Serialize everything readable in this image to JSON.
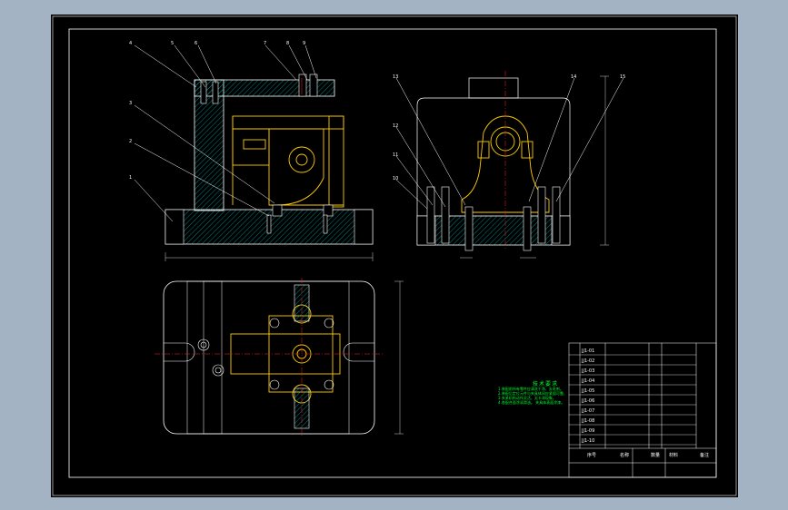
{
  "colors": {
    "background": "#a3b3c4",
    "paper": "#000000",
    "frame": "#ffffff",
    "hatch": "#00a0a0",
    "fixture_part": "#ffcc00",
    "center_line": "#ff2020",
    "leader": "#ffffff",
    "note_text": "#00ff33"
  },
  "front_view_labels": [
    "4",
    "5",
    "6",
    "7",
    "8",
    "9",
    "3",
    "2",
    "1"
  ],
  "side_view_labels": [
    "13",
    "12",
    "11",
    "10",
    "14",
    "15"
  ],
  "tech_requirements": {
    "title": "技术要求",
    "lines": [
      "1.装配前所有零件应清洗干净，去毛刺。",
      "2.装配后定位元件与夹具体间应紧固可靠，",
      "3.夹紧机构动作灵活，无卡滞现象。",
      "4.各配合面涂润滑油。   夹具体表面涂漆。"
    ]
  },
  "title_block": {
    "cells": [
      "JJ1-01",
      "JJ1-02",
      "JJ1-03",
      "JJ1-04",
      "JJ1-05",
      "JJ1-06",
      "JJ1-07",
      "JJ1-08",
      "JJ1-09",
      "JJ1-10"
    ],
    "footer": [
      "序号",
      "名称",
      "数量",
      "材料",
      "备注"
    ]
  }
}
